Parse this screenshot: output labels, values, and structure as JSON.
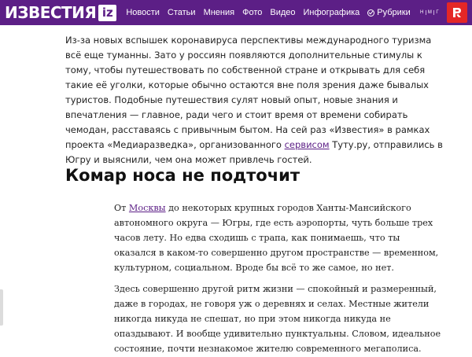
{
  "header": {
    "logo_text": "ИЗВЕСТИЯ",
    "logo_badge": "iz",
    "nav": [
      "Новости",
      "Статьи",
      "Мнения",
      "Фото",
      "Видео",
      "Инфографика"
    ],
    "rubrics_label": "Рубрики",
    "nmg": [
      "Н",
      "М",
      "Г"
    ],
    "colors": {
      "header_bg": "#5c1f86",
      "red_button": "#e42727"
    }
  },
  "intro": {
    "text_before_link": "Из-за новых вспышек коронавируса перспективы международного туризма всё еще туманны. Зато у россиян появляются дополнительные стимулы к тому, чтобы путешествовать по собственной стране и открывать для себя такие её уголки, которые обычно остаются вне поля зрения даже бывалых туристов. Подобные путешествия сулят новый опыт, новые знания и впечатления — главное, ради чего и стоит время от времени собирать чемодан, расставаясь с привычным бытом. На сей раз «Известия» в рамках проекта «Медиаразведка», организованного ",
    "link_text": "сервисом",
    "text_after_link": " Туту.ру, отправились в Югру и выяснили, чем она может привлечь гостей."
  },
  "section": {
    "title": "Комар носа не подточит",
    "p1_before": "От ",
    "p1_link": "Москвы",
    "p1_after": " до некоторых крупных городов Ханты-Мансийского автономного округа — Югры, где есть аэропорты, чуть больше трех часов лету. Но едва сходишь с трапа, как понимаешь, что ты оказался в каком-то совершенно другом пространстве — временном, культурном, социальном. Вроде бы всё то же самое, но нет.",
    "p2": "Здесь совершенно другой ритм жизни — спокойный и размеренный, даже в городах, не говоря уж о деревнях и селах. Местные жители никогда никуда не спешат, но при этом никогда никуда не опаздывают. И вообще удивительно пунктуальны. Словом, идеальное состояние, почти незнакомое жителю современного мегаполиса."
  }
}
